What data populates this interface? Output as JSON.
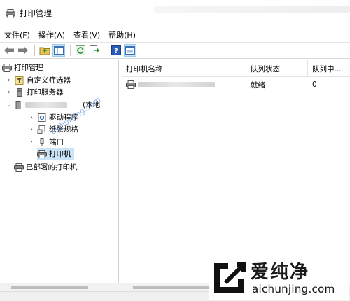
{
  "window": {
    "title": "打印管理"
  },
  "menu": [
    "文件(F)",
    "操作(A)",
    "查看(V)",
    "帮助(H)"
  ],
  "toolbar": [
    "back-icon",
    "forward-icon",
    "up-folder-icon",
    "show-hide-tree-icon",
    "refresh-icon",
    "export-list-icon",
    "help-icon",
    "console-icon"
  ],
  "tree": {
    "root": "打印管理",
    "custom_filters": "自定义筛选器",
    "print_servers": "打印服务器",
    "server_suffix": "(本地",
    "drivers": "驱动程序",
    "forms": "纸张规格",
    "ports": "端口",
    "printers": "打印机",
    "deployed_printers": "已部署的打印机"
  },
  "list": {
    "columns": [
      "打印机名称",
      "队列状态",
      "队列中..."
    ],
    "rows": [
      {
        "name": "",
        "status": "就绪",
        "jobs": "0"
      }
    ]
  },
  "watermark": {
    "brand": "爱纯净",
    "url": "aichunjing.com",
    "diagonal": "aichunjing.com"
  }
}
